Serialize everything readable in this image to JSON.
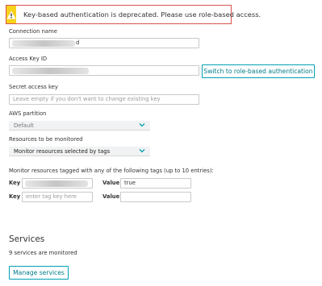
{
  "warning": {
    "message": "Key-based authentication is deprecated. Please use role-based access."
  },
  "connection_name": {
    "label": "Connection name",
    "value_suffix": "d"
  },
  "access_key": {
    "label": "Access Key ID"
  },
  "switch_button": {
    "label": "Switch to role-based authentication"
  },
  "secret_key": {
    "label": "Secret access key",
    "placeholder": "Leave empty if you don't want to change existing key"
  },
  "aws_partition": {
    "label": "AWS partition",
    "selected": "Default"
  },
  "resources": {
    "label": "Resources to be monitored",
    "selected": "Monitor resources selected by tags"
  },
  "tags": {
    "description": "Monitor resources tagged with any of the following tags (up to 10 entries):",
    "key_label": "Key",
    "value_label": "Value",
    "rows": [
      {
        "key": "",
        "key_placeholder": "",
        "value": "true"
      },
      {
        "key": "",
        "key_placeholder": "enter tag key here",
        "value": ""
      }
    ]
  },
  "services": {
    "heading": "Services",
    "count_text": "9 services are monitored",
    "manage_label": "Manage services"
  },
  "colors": {
    "accent": "#00a1b3",
    "warning_yellow": "#f7d21d",
    "warning_border": "#d9534f"
  },
  "icons": {
    "warning": "warning-triangle-icon",
    "chevron": "chevron-down-icon"
  }
}
